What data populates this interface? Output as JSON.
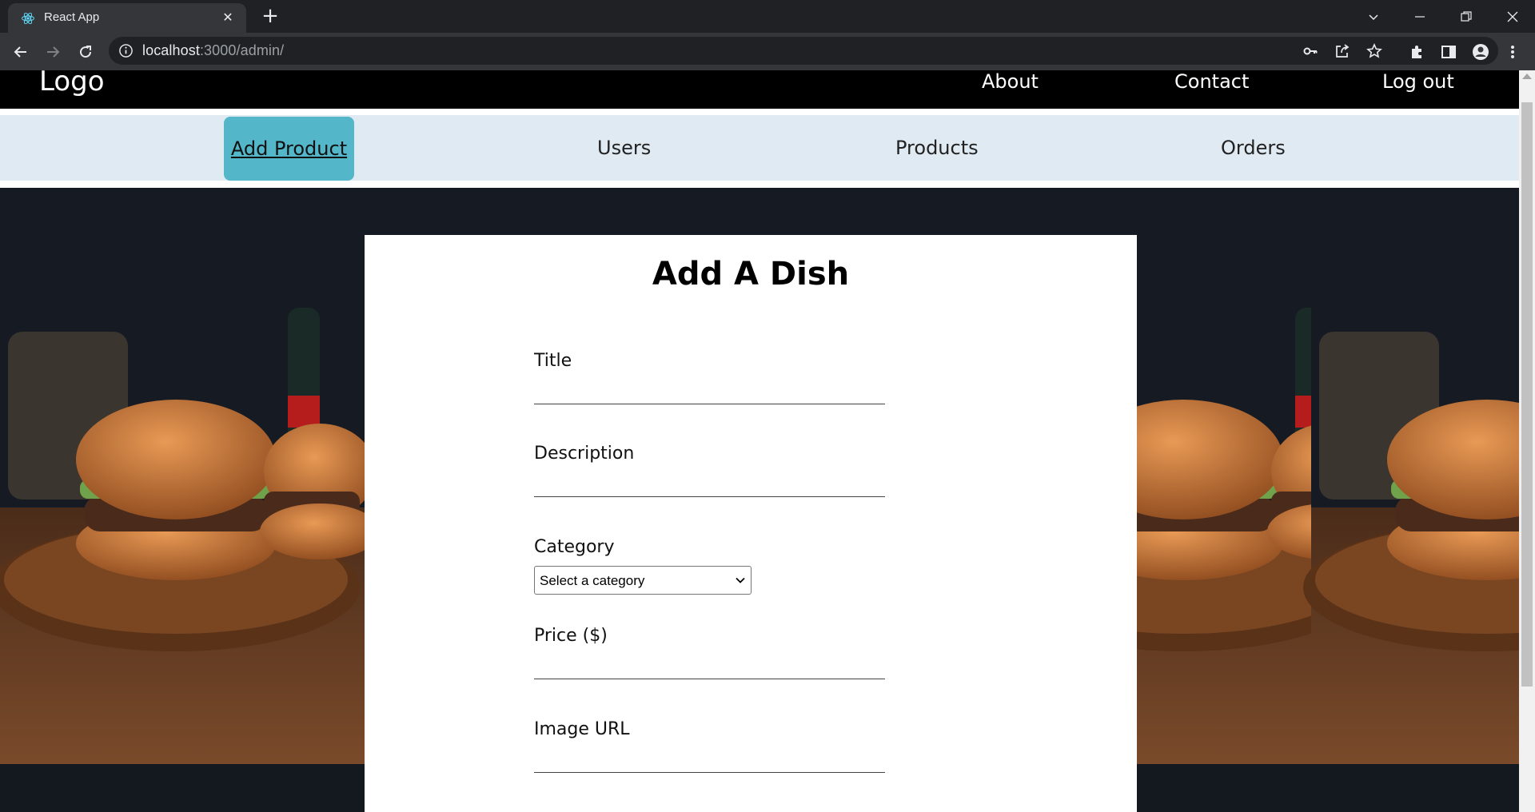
{
  "browser": {
    "tab_title": "React App",
    "url_host": "localhost",
    "url_rest": ":3000/admin/"
  },
  "site": {
    "logo": "Logo",
    "top_links": [
      "About",
      "Contact",
      "Log out"
    ]
  },
  "admin_nav": {
    "items": [
      "Add Product",
      "Users",
      "Products",
      "Orders"
    ],
    "active": "Add Product"
  },
  "form": {
    "title": "Add A Dish",
    "fields": {
      "title_label": "Title",
      "description_label": "Description",
      "category_label": "Category",
      "category_selected": "Select a category",
      "price_label": "Price ($)",
      "image_label": "Image URL"
    }
  },
  "colors": {
    "active_tab": "#54b6c9",
    "admin_nav_bg": "#e0eaf2",
    "topnav_bg": "#000000"
  }
}
